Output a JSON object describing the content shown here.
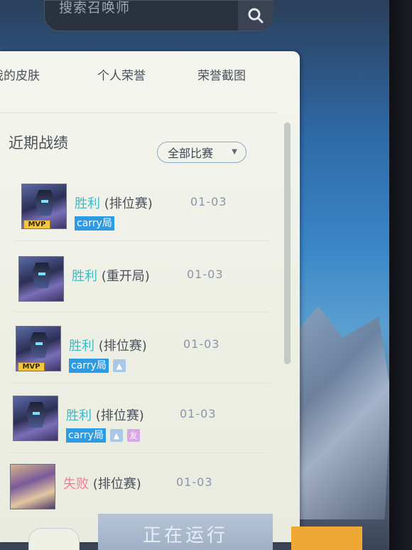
{
  "search": {
    "placeholder": "搜索召唤师"
  },
  "tabs": [
    {
      "label": "我的皮肤"
    },
    {
      "label": "个人荣誉"
    },
    {
      "label": "荣誉截图"
    }
  ],
  "section": {
    "title": "近期战绩"
  },
  "filter": {
    "label": "全部比赛"
  },
  "matches": [
    {
      "result": "胜利",
      "mode": " (排位赛)",
      "date": "01-03",
      "mvp": "MVP",
      "carry": "carry局"
    },
    {
      "result": "胜利",
      "mode": " (重开局)",
      "date": "01-03"
    },
    {
      "result": "胜利",
      "mode": " (排位赛)",
      "date": "01-03",
      "mvp": "MVP",
      "carry": "carry局"
    },
    {
      "result": "胜利",
      "mode": " (排位赛)",
      "date": "01-03",
      "carry": "carry局",
      "friend": "友"
    },
    {
      "result": "失败",
      "mode": " (排位赛)",
      "date": "01-03"
    }
  ],
  "bottom": {
    "running_label": "正在运行"
  },
  "colors": {
    "win": "#43b9c2",
    "lose": "#f07e9a",
    "carry": "#2c9be3",
    "mvp": "#f2c542"
  }
}
